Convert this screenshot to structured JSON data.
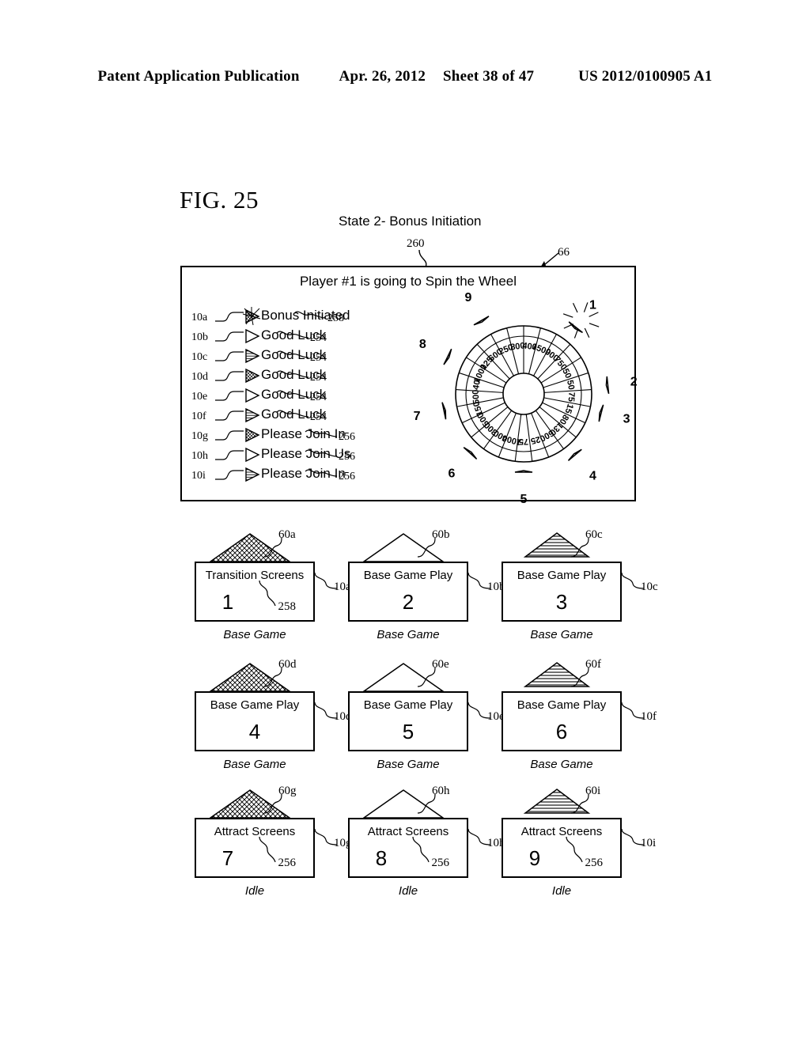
{
  "header": {
    "publication": "Patent Application Publication",
    "date": "Apr. 26, 2012",
    "sheet": "Sheet 38 of 47",
    "number": "US 2012/0100905 A1"
  },
  "figure": {
    "label": "FIG. 25",
    "state_caption": "State 2- Bonus Initiation",
    "panel_ref": "260",
    "system_ref": "66"
  },
  "panel": {
    "title": "Player #1 is going to Spin the Wheel",
    "messages": [
      {
        "tag": "10a",
        "text": "Bonus Initiated",
        "ref": "258",
        "icon": "triangle-crosshatch-sparkle-icon",
        "fill": "crosshatch",
        "sparkle": true
      },
      {
        "tag": "10b",
        "text": "Good Luck",
        "ref": "254",
        "icon": "triangle-plain-icon",
        "fill": "plain",
        "sparkle": false
      },
      {
        "tag": "10c",
        "text": "Good Luck",
        "ref": "254",
        "icon": "triangle-striped-icon",
        "fill": "stripes",
        "sparkle": false
      },
      {
        "tag": "10d",
        "text": "Good Luck",
        "ref": "254",
        "icon": "triangle-crosshatch-icon",
        "fill": "crosshatch",
        "sparkle": false
      },
      {
        "tag": "10e",
        "text": "Good Luck",
        "ref": "254",
        "icon": "triangle-plain-icon",
        "fill": "plain",
        "sparkle": false
      },
      {
        "tag": "10f",
        "text": "Good Luck",
        "ref": "254",
        "icon": "triangle-striped-icon",
        "fill": "stripes",
        "sparkle": false
      },
      {
        "tag": "10g",
        "text": "Please Join In",
        "ref": "256",
        "icon": "triangle-crosshatch-icon",
        "fill": "crosshatch",
        "sparkle": false
      },
      {
        "tag": "10h",
        "text": "Please Join Us",
        "ref": "256",
        "icon": "triangle-plain-icon",
        "fill": "plain",
        "sparkle": false
      },
      {
        "tag": "10i",
        "text": "Please Join In",
        "ref": "256",
        "icon": "triangle-striped-icon",
        "fill": "stripes",
        "sparkle": false
      }
    ]
  },
  "wheel": {
    "name": "bonus-prize-wheel",
    "segment_values": [
      "400",
      "1500",
      "900",
      "750",
      "50",
      "50",
      "75",
      "15",
      "80",
      "130",
      "600",
      "25",
      "75",
      "1000",
      "400",
      "300",
      "500",
      "150",
      "500",
      "40",
      "1000",
      "125",
      "600",
      "250",
      "800"
    ],
    "markers": [
      {
        "label": "1",
        "fill": "crosshatch",
        "sparkle": true
      },
      {
        "label": "2",
        "fill": "plain",
        "sparkle": false
      },
      {
        "label": "3",
        "fill": "stripes",
        "sparkle": false
      },
      {
        "label": "4",
        "fill": "crosshatch",
        "sparkle": false
      },
      {
        "label": "5",
        "fill": "plain",
        "sparkle": false
      },
      {
        "label": "6",
        "fill": "stripes",
        "sparkle": false
      },
      {
        "label": "7",
        "fill": "crosshatch",
        "sparkle": false
      },
      {
        "label": "8",
        "fill": "plain",
        "sparkle": false
      },
      {
        "label": "9",
        "fill": "stripes",
        "sparkle": false
      }
    ]
  },
  "screens": [
    {
      "roof_ref": "60a",
      "title": "Transition Screens",
      "number": "1",
      "inner_ref": "258",
      "cell_ref": "10a",
      "caption": "Base Game",
      "fill": "crosshatch"
    },
    {
      "roof_ref": "60b",
      "title": "Base Game Play",
      "number": "2",
      "inner_ref": "",
      "cell_ref": "10b",
      "caption": "Base Game",
      "fill": "plain"
    },
    {
      "roof_ref": "60c",
      "title": "Base Game Play",
      "number": "3",
      "inner_ref": "",
      "cell_ref": "10c",
      "caption": "Base Game",
      "fill": "stripes"
    },
    {
      "roof_ref": "60d",
      "title": "Base Game Play",
      "number": "4",
      "inner_ref": "",
      "cell_ref": "10d",
      "caption": "Base Game",
      "fill": "crosshatch"
    },
    {
      "roof_ref": "60e",
      "title": "Base Game Play",
      "number": "5",
      "inner_ref": "",
      "cell_ref": "10e",
      "caption": "Base Game",
      "fill": "plain"
    },
    {
      "roof_ref": "60f",
      "title": "Base Game Play",
      "number": "6",
      "inner_ref": "",
      "cell_ref": "10f",
      "caption": "Base Game",
      "fill": "stripes"
    },
    {
      "roof_ref": "60g",
      "title": "Attract Screens",
      "number": "7",
      "inner_ref": "256",
      "cell_ref": "10g",
      "caption": "Idle",
      "fill": "crosshatch"
    },
    {
      "roof_ref": "60h",
      "title": "Attract Screens",
      "number": "8",
      "inner_ref": "256",
      "cell_ref": "10h",
      "caption": "Idle",
      "fill": "plain"
    },
    {
      "roof_ref": "60i",
      "title": "Attract Screens",
      "number": "9",
      "inner_ref": "256",
      "cell_ref": "10i",
      "caption": "Idle",
      "fill": "stripes"
    }
  ]
}
